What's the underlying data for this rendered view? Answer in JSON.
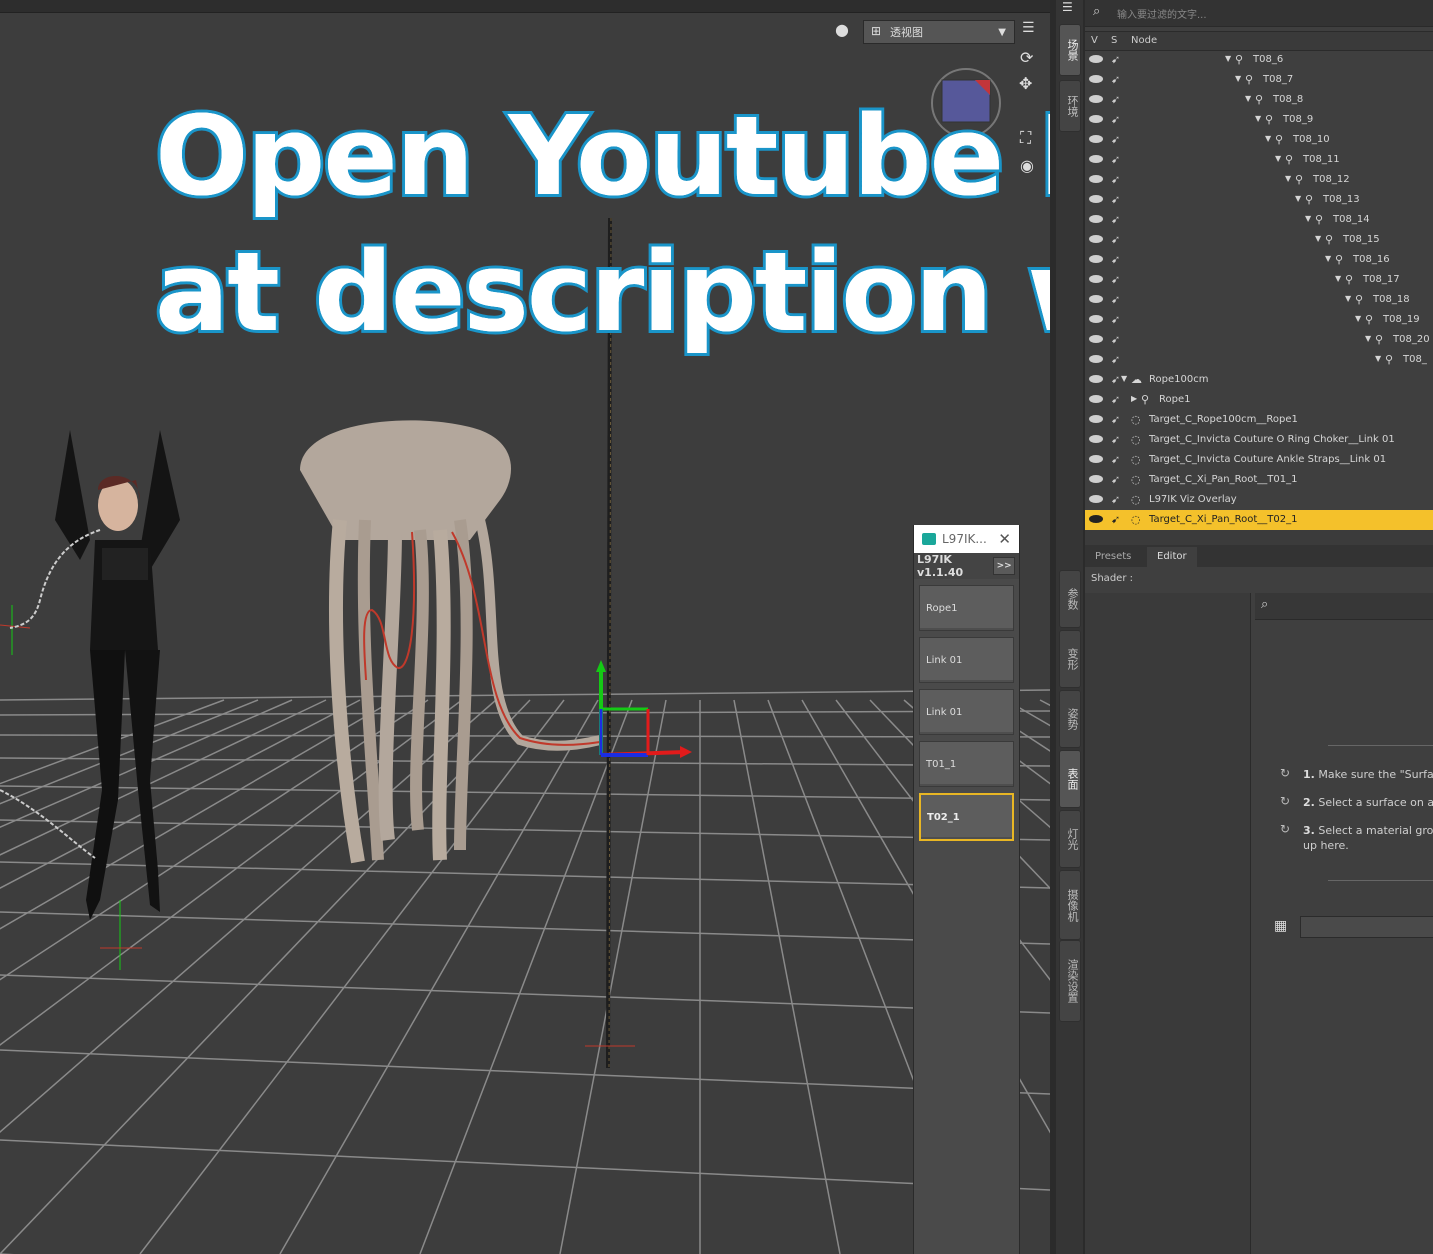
{
  "viewport": {
    "view_label": "透视图",
    "overlay_line1": "Open Youtube  Demo",
    "overlay_line2": "at description words"
  },
  "ik_panel": {
    "title": "L97IK...",
    "version": "L97IK v1.1.40",
    "expand": ">>",
    "buttons": [
      "Rope1",
      "Link 01",
      "Link 01",
      "T01_1",
      "T02_1"
    ]
  },
  "scene": {
    "search_placeholder": "输入要过滤的文字...",
    "col_v": "V",
    "col_s": "S",
    "col_node": "Node",
    "tabs": [
      "场景",
      "环境"
    ],
    "rows": [
      {
        "name": "T08_6",
        "indent": 150
      },
      {
        "name": "T08_7",
        "indent": 160
      },
      {
        "name": "T08_8",
        "indent": 170
      },
      {
        "name": "T08_9",
        "indent": 180
      },
      {
        "name": "T08_10",
        "indent": 190
      },
      {
        "name": "T08_11",
        "indent": 200
      },
      {
        "name": "T08_12",
        "indent": 210
      },
      {
        "name": "T08_13",
        "indent": 220
      },
      {
        "name": "T08_14",
        "indent": 230
      },
      {
        "name": "T08_15",
        "indent": 240
      },
      {
        "name": "T08_16",
        "indent": 250
      },
      {
        "name": "T08_17",
        "indent": 260
      },
      {
        "name": "T08_18",
        "indent": 270
      },
      {
        "name": "T08_19",
        "indent": 280
      },
      {
        "name": "T08_20",
        "indent": 290
      },
      {
        "name": "T08_",
        "indent": 300
      },
      {
        "name": "Rope100cm",
        "indent": 46
      },
      {
        "name": "Rope1",
        "indent": 56
      },
      {
        "name": "Target_C_Rope100cm__Rope1",
        "indent": 46
      },
      {
        "name": "Target_C_Invicta Couture O Ring Choker__Link 01",
        "indent": 46
      },
      {
        "name": "Target_C_Invicta Couture Ankle Straps__Link 01",
        "indent": 46
      },
      {
        "name": "Target_C_Xi_Pan_Root__T01_1",
        "indent": 46
      },
      {
        "name": "L97IK Viz Overlay",
        "indent": 46
      },
      {
        "name": "Target_C_Xi_Pan_Root__T02_1",
        "indent": 46
      }
    ]
  },
  "surfaces": {
    "tabs": [
      "Presets",
      "Editor"
    ],
    "shader_label": "Shader :",
    "side_tabs": [
      "参数",
      "变形",
      "姿势",
      "表面",
      "灯光",
      "摄像机",
      "渲染设置"
    ],
    "step1_num": "1.",
    "step1": "Make sure the \"Surfac",
    "step2_num": "2.",
    "step2": "Select a surface on ar",
    "step3_num": "3.",
    "step3": "Select a material grou",
    "step3b": "up here."
  },
  "colors": {
    "accent_selected": "#f4c12b",
    "overlay_stroke": "#1a95c9",
    "ik_active_border": "#e8b624"
  }
}
